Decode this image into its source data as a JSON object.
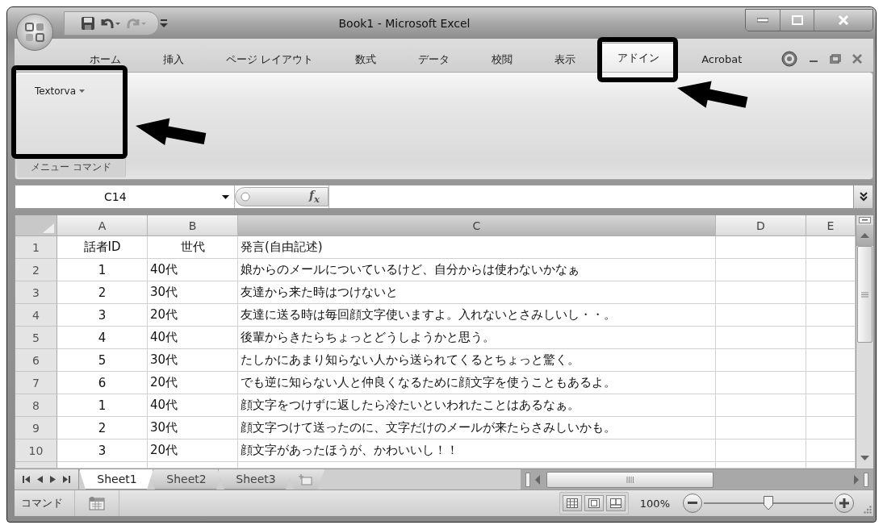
{
  "window": {
    "title": "Book1 - Microsoft Excel"
  },
  "ribbon_tabs": [
    {
      "label": "ホーム",
      "selected": false
    },
    {
      "label": "挿入",
      "selected": false
    },
    {
      "label": "ページ レイアウト",
      "selected": false
    },
    {
      "label": "数式",
      "selected": false
    },
    {
      "label": "データ",
      "selected": false
    },
    {
      "label": "校閲",
      "selected": false
    },
    {
      "label": "表示",
      "selected": false
    },
    {
      "label": "アドイン",
      "selected": true
    },
    {
      "label": "Acrobat",
      "selected": false
    }
  ],
  "ribbon_group": {
    "button": "Textorva",
    "label": "メニュー コマンド"
  },
  "formula_bar": {
    "name_box": "C14",
    "function_label": "f$_{x}$"
  },
  "sheet": {
    "columns": [
      {
        "label": "A",
        "selected": false
      },
      {
        "label": "B",
        "selected": false
      },
      {
        "label": "C",
        "selected": true
      },
      {
        "label": "D",
        "selected": false
      },
      {
        "label": "E",
        "selected": false
      }
    ],
    "rows": [
      {
        "number": "1",
        "cells": [
          "話者ID",
          "世代",
          "発言(自由記述)"
        ]
      },
      {
        "number": "2",
        "cells": [
          "1",
          "40代",
          "娘からのメールについているけど、自分からは使わないかなぁ"
        ]
      },
      {
        "number": "3",
        "cells": [
          "2",
          "30代",
          "友達から来た時はつけないと"
        ]
      },
      {
        "number": "4",
        "cells": [
          "3",
          "20代",
          "友達に送る時は毎回顔文字使いますよ。入れないとさみしいし・・。"
        ]
      },
      {
        "number": "5",
        "cells": [
          "4",
          "40代",
          "後輩からきたらちょっとどうしようかと思う。"
        ]
      },
      {
        "number": "6",
        "cells": [
          "5",
          "30代",
          "たしかにあまり知らない人から送られてくるとちょっと驚く。"
        ]
      },
      {
        "number": "7",
        "cells": [
          "6",
          "20代",
          "でも逆に知らない人と仲良くなるために顔文字を使うこともあるよ。"
        ]
      },
      {
        "number": "8",
        "cells": [
          "1",
          "40代",
          "顔文字をつけずに返したら冷たいといわれたことはあるなぁ。"
        ]
      },
      {
        "number": "9",
        "cells": [
          "2",
          "30代",
          "顔文字つけて送ったのに、文字だけのメールが来たらさみしいかも。"
        ]
      },
      {
        "number": "10",
        "cells": [
          "3",
          "20代",
          "顔文字があったほうが、かわいいし！！"
        ]
      }
    ]
  },
  "sheet_tabs": [
    {
      "label": "Sheet1",
      "selected": true
    },
    {
      "label": "Sheet2",
      "selected": false
    },
    {
      "label": "Sheet3",
      "selected": false
    }
  ],
  "status_bar": {
    "mode": "コマンド",
    "zoom": "100%",
    "zoom_slider": {
      "level": 0.5
    }
  }
}
